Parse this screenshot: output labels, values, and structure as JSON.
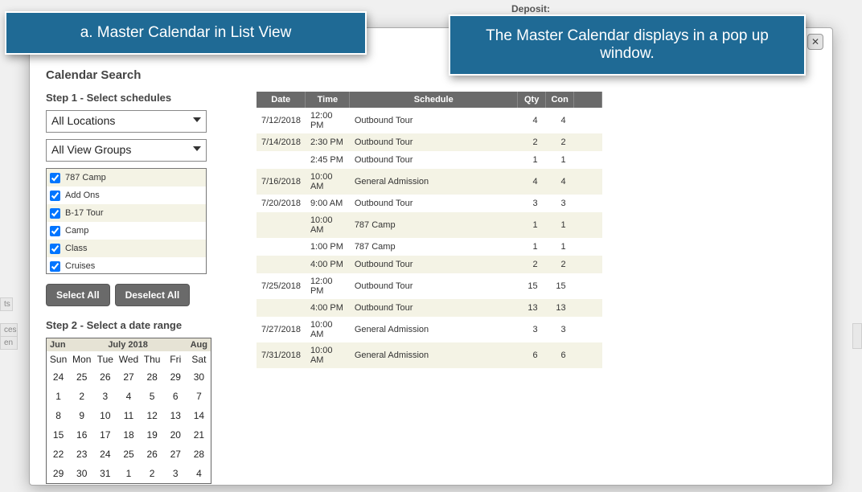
{
  "bg": {
    "deposit_label": "Deposit:"
  },
  "sidebar_fragments": [
    "ts",
    "ces",
    "en"
  ],
  "popup": {
    "close_glyph": "✕",
    "search_title": "Calendar Search",
    "step1_label": "Step 1 - Select schedules",
    "location_select": "All Locations",
    "group_select": "All View Groups",
    "schedule_items": [
      {
        "label": "787 Camp",
        "checked": true
      },
      {
        "label": "Add Ons",
        "checked": true
      },
      {
        "label": "B-17 Tour",
        "checked": true
      },
      {
        "label": "Camp",
        "checked": true
      },
      {
        "label": "Class",
        "checked": true
      },
      {
        "label": "Cruises",
        "checked": true
      }
    ],
    "select_all": "Select All",
    "deselect_all": "Deselect All",
    "step2_label": "Step 2 - Select a date range",
    "cal": {
      "prev": "Jun",
      "title": "July 2018",
      "next": "Aug",
      "dow": [
        "Sun",
        "Mon",
        "Tue",
        "Wed",
        "Thu",
        "Fri",
        "Sat"
      ],
      "days": [
        24,
        25,
        26,
        27,
        28,
        29,
        30,
        1,
        2,
        3,
        4,
        5,
        6,
        7,
        8,
        9,
        10,
        11,
        12,
        13,
        14,
        15,
        16,
        17,
        18,
        19,
        20,
        21,
        22,
        23,
        24,
        25,
        26,
        27,
        28,
        29,
        30,
        31,
        1,
        2,
        3,
        4
      ]
    },
    "table": {
      "headers": [
        "Date",
        "Time",
        "Schedule",
        "Qty",
        "Con"
      ],
      "rows": [
        {
          "date": "7/12/2018",
          "time": "12:00 PM",
          "sched": "Outbound Tour",
          "qty": 4,
          "con": 4
        },
        {
          "date": "7/14/2018",
          "time": "2:30 PM",
          "sched": "Outbound Tour",
          "qty": 2,
          "con": 2
        },
        {
          "date": "",
          "time": "2:45 PM",
          "sched": "Outbound Tour",
          "qty": 1,
          "con": 1
        },
        {
          "date": "7/16/2018",
          "time": "10:00 AM",
          "sched": "General Admission",
          "qty": 4,
          "con": 4
        },
        {
          "date": "7/20/2018",
          "time": "9:00 AM",
          "sched": "Outbound Tour",
          "qty": 3,
          "con": 3
        },
        {
          "date": "",
          "time": "10:00 AM",
          "sched": "787 Camp",
          "qty": 1,
          "con": 1
        },
        {
          "date": "",
          "time": "1:00 PM",
          "sched": "787 Camp",
          "qty": 1,
          "con": 1
        },
        {
          "date": "",
          "time": "4:00 PM",
          "sched": "Outbound Tour",
          "qty": 2,
          "con": 2
        },
        {
          "date": "7/25/2018",
          "time": "12:00 PM",
          "sched": "Outbound Tour",
          "qty": 15,
          "con": 15
        },
        {
          "date": "",
          "time": "4:00 PM",
          "sched": "Outbound Tour",
          "qty": 13,
          "con": 13
        },
        {
          "date": "7/27/2018",
          "time": "10:00 AM",
          "sched": "General Admission",
          "qty": 3,
          "con": 3
        },
        {
          "date": "7/31/2018",
          "time": "10:00 AM",
          "sched": "General Admission",
          "qty": 6,
          "con": 6
        }
      ]
    }
  },
  "callouts": {
    "a": "a. Master Calendar in List View",
    "b": "The Master Calendar displays in a pop up window."
  }
}
